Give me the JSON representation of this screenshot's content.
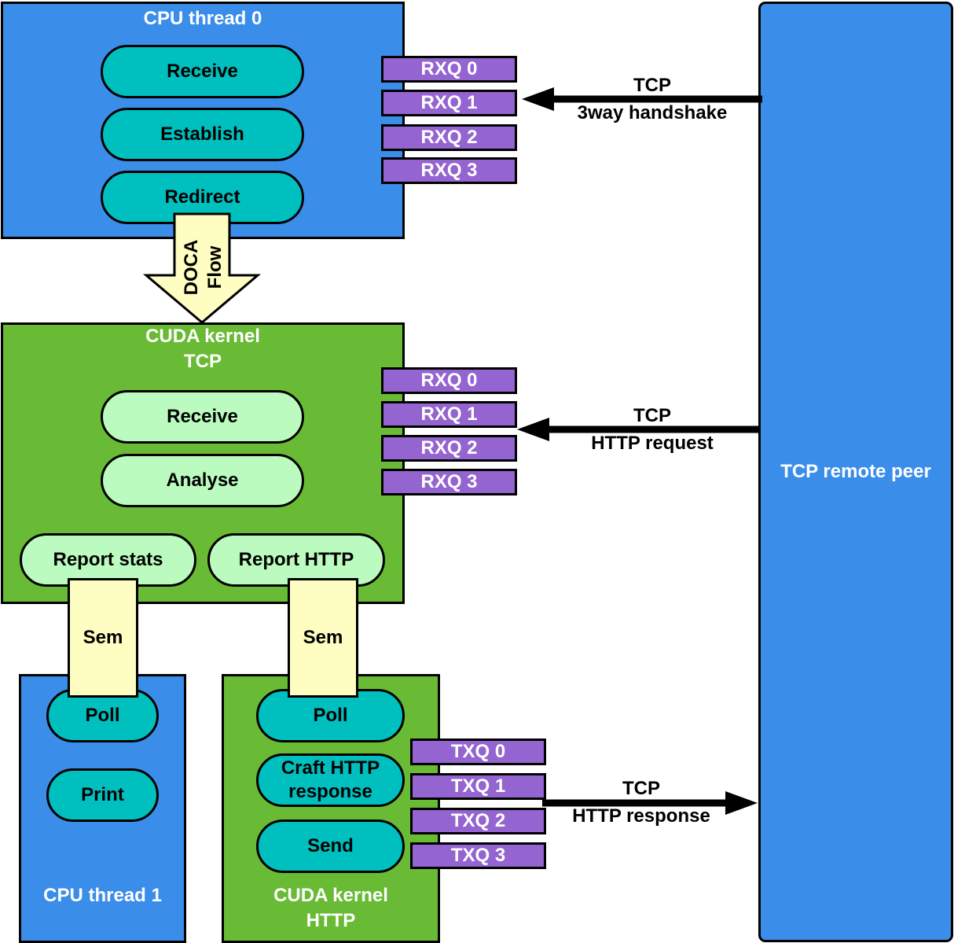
{
  "colors": {
    "cpu_blue": "#3b8dea",
    "cuda_green": "#69bb35",
    "teal_step": "#00bfbf",
    "mint_step": "#bbfbbf",
    "queue_purple": "#9464d0",
    "semaphore_yellow": "#fefec2",
    "doca_arrow_yellow": "#fefec2"
  },
  "cpu_thread_0": {
    "title": "CPU thread 0",
    "steps": [
      "Receive",
      "Establish",
      "Redirect"
    ],
    "queues": [
      "RXQ 0",
      "RXQ 1",
      "RXQ 2",
      "RXQ 3"
    ]
  },
  "doca_flow": {
    "line1": "DOCA",
    "line2": "Flow"
  },
  "cuda_kernel_tcp": {
    "title_line1": "CUDA kernel",
    "title_line2": "TCP",
    "steps": [
      "Receive",
      "Analyse"
    ],
    "report_stats": "Report stats",
    "report_http": "Report HTTP",
    "queues": [
      "RXQ 0",
      "RXQ 1",
      "RXQ 2",
      "RXQ 3"
    ]
  },
  "semaphores": [
    "Sem",
    "Sem"
  ],
  "cpu_thread_1": {
    "title": "CPU thread 1",
    "steps": [
      "Poll",
      "Print"
    ]
  },
  "cuda_kernel_http": {
    "title_line1": "CUDA kernel",
    "title_line2": "HTTP",
    "steps": [
      "Poll",
      "Craft HTTP\nresponse",
      "Send"
    ],
    "craft_line1": "Craft HTTP",
    "craft_line2": "response",
    "queues": [
      "TXQ 0",
      "TXQ 1",
      "TXQ 2",
      "TXQ 3"
    ]
  },
  "arrows": {
    "handshake": {
      "line1": "TCP",
      "line2": "3way handshake",
      "direction": "to-left"
    },
    "request": {
      "line1": "TCP",
      "line2": "HTTP request",
      "direction": "to-left"
    },
    "response": {
      "line1": "TCP",
      "line2": "HTTP response",
      "direction": "to-right"
    }
  },
  "remote_peer": {
    "label": "TCP remote peer"
  }
}
